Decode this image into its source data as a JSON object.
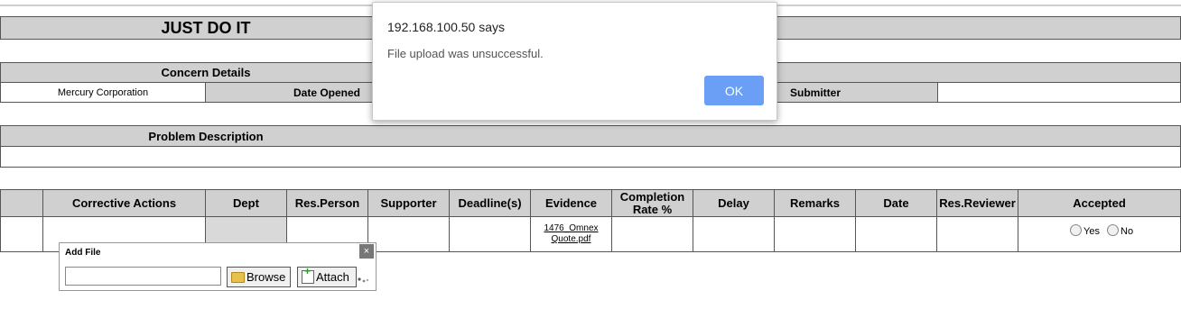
{
  "page_title": "JUST DO IT",
  "concern": {
    "header": "Concern Details",
    "company": "Mercury Corporation",
    "date_opened_label": "Date Opened",
    "submitter_label": "Submitter"
  },
  "problem": {
    "header": "Problem Description"
  },
  "actions_table": {
    "headers": [
      "Corrective Actions",
      "Dept",
      "Res.Person",
      "Supporter",
      "Deadline(s)",
      "Evidence",
      "Completion Rate %",
      "Delay",
      "Remarks",
      "Date",
      "Res.Reviewer",
      "Accepted"
    ],
    "completion_line1": "Completion",
    "completion_line2": "Rate %",
    "row": {
      "evidence_line1": "1476_Omnex",
      "evidence_line2": "Quote.pdf",
      "yes_label": "Yes",
      "no_label": "No"
    }
  },
  "add_file": {
    "title": "Add File",
    "close": "×",
    "browse_label": "Browse",
    "attach_label": "Attach",
    "file_value": ""
  },
  "dialog": {
    "title": "192.168.100.50 says",
    "message": "File upload was unsuccessful.",
    "ok_label": "OK"
  },
  "colors": {
    "header_bg": "#d0d0d0",
    "ok_button": "#6a9ff5"
  }
}
